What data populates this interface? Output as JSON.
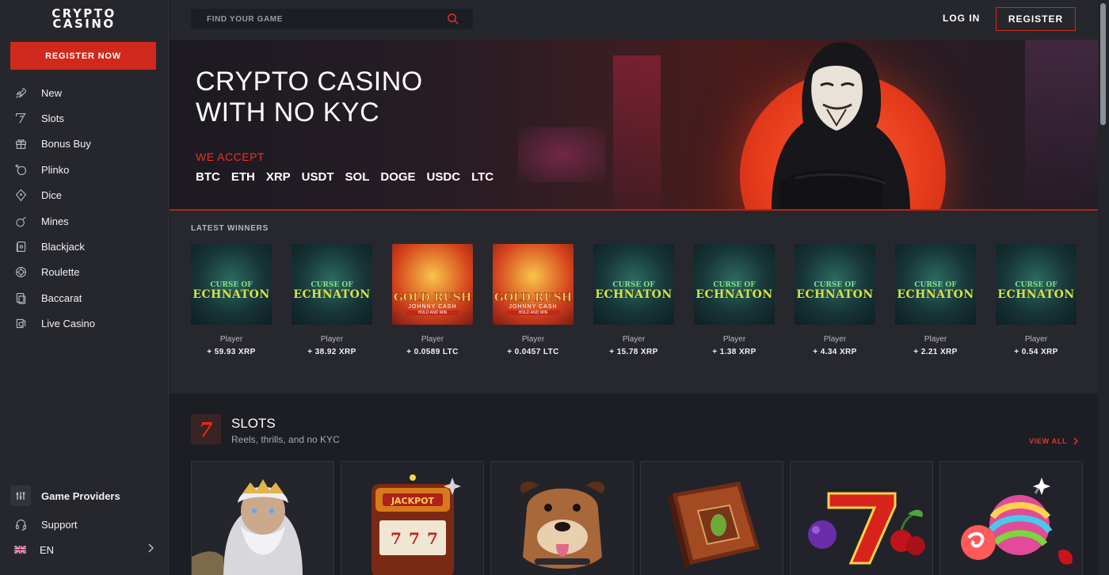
{
  "brand": {
    "line1": "CRYPTO",
    "line2": "CASINO"
  },
  "sidebar": {
    "register_now": "REGISTER NOW",
    "items": [
      {
        "label": "New",
        "icon": "rocket-icon"
      },
      {
        "label": "Slots",
        "icon": "slot-seven-icon"
      },
      {
        "label": "Bonus Buy",
        "icon": "gift-icon"
      },
      {
        "label": "Plinko",
        "icon": "plinko-icon"
      },
      {
        "label": "Dice",
        "icon": "dice-icon"
      },
      {
        "label": "Mines",
        "icon": "bomb-icon"
      },
      {
        "label": "Blackjack",
        "icon": "cards-icon"
      },
      {
        "label": "Roulette",
        "icon": "roulette-icon"
      },
      {
        "label": "Baccarat",
        "icon": "baccarat-icon"
      },
      {
        "label": "Live Casino",
        "icon": "live-casino-icon"
      }
    ],
    "game_providers": "Game Providers",
    "support": "Support",
    "language": "EN"
  },
  "header": {
    "search_placeholder": "FIND YOUR GAME",
    "login": "LOG IN",
    "register": "REGISTER"
  },
  "hero": {
    "title_line1": "CRYPTO CASINO",
    "title_line2": "WITH NO KYC",
    "we_accept": "WE ACCEPT",
    "coins": [
      "BTC",
      "ETH",
      "XRP",
      "USDT",
      "SOL",
      "DOGE",
      "USDC",
      "LTC"
    ]
  },
  "winners": {
    "title": "LATEST WINNERS",
    "items": [
      {
        "game": "curse",
        "player": "Player",
        "amount": "+ 59.93 XRP"
      },
      {
        "game": "curse",
        "player": "Player",
        "amount": "+ 38.92 XRP"
      },
      {
        "game": "gold",
        "player": "Player",
        "amount": "+ 0.0589 LTC"
      },
      {
        "game": "gold",
        "player": "Player",
        "amount": "+ 0.0457 LTC"
      },
      {
        "game": "curse",
        "player": "Player",
        "amount": "+ 15.78 XRP"
      },
      {
        "game": "curse",
        "player": "Player",
        "amount": "+ 1.38 XRP"
      },
      {
        "game": "curse",
        "player": "Player",
        "amount": "+ 4.34 XRP"
      },
      {
        "game": "curse",
        "player": "Player",
        "amount": "+ 2.21 XRP"
      },
      {
        "game": "curse",
        "player": "Player",
        "amount": "+ 0.54 XRP"
      }
    ],
    "thumb_text": {
      "curse_top": "CURSE OF",
      "curse_main": "ECHNATON",
      "gold_main": "GOLD RUSH",
      "gold_sub": "JOHNNY CASH",
      "gold_tag": "HOLD AND WIN"
    }
  },
  "slots": {
    "icon_glyph": "7",
    "title": "SLOTS",
    "subtitle": "Reels, thrills, and no KYC",
    "view_all": "VIEW ALL",
    "jackpot_label": "JACKPOT",
    "cards": [
      "zeus-art",
      "jackpot-machine-art",
      "bulldog-art",
      "spellbook-art",
      "lucky-seven-art",
      "candy-bomb-art"
    ]
  },
  "colors": {
    "accent": "#d0281c",
    "bg": "#1d1e24",
    "sidebar": "#26272d"
  }
}
